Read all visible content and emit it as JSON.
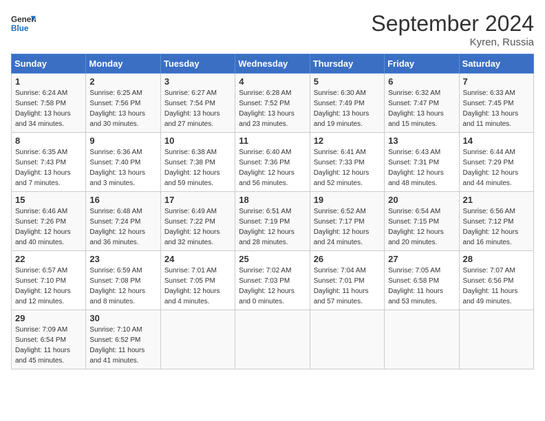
{
  "header": {
    "logo_general": "General",
    "logo_blue": "Blue",
    "month_title": "September 2024",
    "location": "Kyren, Russia"
  },
  "days_of_week": [
    "Sunday",
    "Monday",
    "Tuesday",
    "Wednesday",
    "Thursday",
    "Friday",
    "Saturday"
  ],
  "weeks": [
    [
      {
        "day": 1,
        "sunrise": "6:24 AM",
        "sunset": "7:58 PM",
        "daylight": "13 hours and 34 minutes."
      },
      {
        "day": 2,
        "sunrise": "6:25 AM",
        "sunset": "7:56 PM",
        "daylight": "13 hours and 30 minutes."
      },
      {
        "day": 3,
        "sunrise": "6:27 AM",
        "sunset": "7:54 PM",
        "daylight": "13 hours and 27 minutes."
      },
      {
        "day": 4,
        "sunrise": "6:28 AM",
        "sunset": "7:52 PM",
        "daylight": "13 hours and 23 minutes."
      },
      {
        "day": 5,
        "sunrise": "6:30 AM",
        "sunset": "7:49 PM",
        "daylight": "13 hours and 19 minutes."
      },
      {
        "day": 6,
        "sunrise": "6:32 AM",
        "sunset": "7:47 PM",
        "daylight": "13 hours and 15 minutes."
      },
      {
        "day": 7,
        "sunrise": "6:33 AM",
        "sunset": "7:45 PM",
        "daylight": "13 hours and 11 minutes."
      }
    ],
    [
      {
        "day": 8,
        "sunrise": "6:35 AM",
        "sunset": "7:43 PM",
        "daylight": "13 hours and 7 minutes."
      },
      {
        "day": 9,
        "sunrise": "6:36 AM",
        "sunset": "7:40 PM",
        "daylight": "13 hours and 3 minutes."
      },
      {
        "day": 10,
        "sunrise": "6:38 AM",
        "sunset": "7:38 PM",
        "daylight": "12 hours and 59 minutes."
      },
      {
        "day": 11,
        "sunrise": "6:40 AM",
        "sunset": "7:36 PM",
        "daylight": "12 hours and 56 minutes."
      },
      {
        "day": 12,
        "sunrise": "6:41 AM",
        "sunset": "7:33 PM",
        "daylight": "12 hours and 52 minutes."
      },
      {
        "day": 13,
        "sunrise": "6:43 AM",
        "sunset": "7:31 PM",
        "daylight": "12 hours and 48 minutes."
      },
      {
        "day": 14,
        "sunrise": "6:44 AM",
        "sunset": "7:29 PM",
        "daylight": "12 hours and 44 minutes."
      }
    ],
    [
      {
        "day": 15,
        "sunrise": "6:46 AM",
        "sunset": "7:26 PM",
        "daylight": "12 hours and 40 minutes."
      },
      {
        "day": 16,
        "sunrise": "6:48 AM",
        "sunset": "7:24 PM",
        "daylight": "12 hours and 36 minutes."
      },
      {
        "day": 17,
        "sunrise": "6:49 AM",
        "sunset": "7:22 PM",
        "daylight": "12 hours and 32 minutes."
      },
      {
        "day": 18,
        "sunrise": "6:51 AM",
        "sunset": "7:19 PM",
        "daylight": "12 hours and 28 minutes."
      },
      {
        "day": 19,
        "sunrise": "6:52 AM",
        "sunset": "7:17 PM",
        "daylight": "12 hours and 24 minutes."
      },
      {
        "day": 20,
        "sunrise": "6:54 AM",
        "sunset": "7:15 PM",
        "daylight": "12 hours and 20 minutes."
      },
      {
        "day": 21,
        "sunrise": "6:56 AM",
        "sunset": "7:12 PM",
        "daylight": "12 hours and 16 minutes."
      }
    ],
    [
      {
        "day": 22,
        "sunrise": "6:57 AM",
        "sunset": "7:10 PM",
        "daylight": "12 hours and 12 minutes."
      },
      {
        "day": 23,
        "sunrise": "6:59 AM",
        "sunset": "7:08 PM",
        "daylight": "12 hours and 8 minutes."
      },
      {
        "day": 24,
        "sunrise": "7:01 AM",
        "sunset": "7:05 PM",
        "daylight": "12 hours and 4 minutes."
      },
      {
        "day": 25,
        "sunrise": "7:02 AM",
        "sunset": "7:03 PM",
        "daylight": "12 hours and 0 minutes."
      },
      {
        "day": 26,
        "sunrise": "7:04 AM",
        "sunset": "7:01 PM",
        "daylight": "11 hours and 57 minutes."
      },
      {
        "day": 27,
        "sunrise": "7:05 AM",
        "sunset": "6:58 PM",
        "daylight": "11 hours and 53 minutes."
      },
      {
        "day": 28,
        "sunrise": "7:07 AM",
        "sunset": "6:56 PM",
        "daylight": "11 hours and 49 minutes."
      }
    ],
    [
      {
        "day": 29,
        "sunrise": "7:09 AM",
        "sunset": "6:54 PM",
        "daylight": "11 hours and 45 minutes."
      },
      {
        "day": 30,
        "sunrise": "7:10 AM",
        "sunset": "6:52 PM",
        "daylight": "11 hours and 41 minutes."
      },
      null,
      null,
      null,
      null,
      null
    ]
  ]
}
